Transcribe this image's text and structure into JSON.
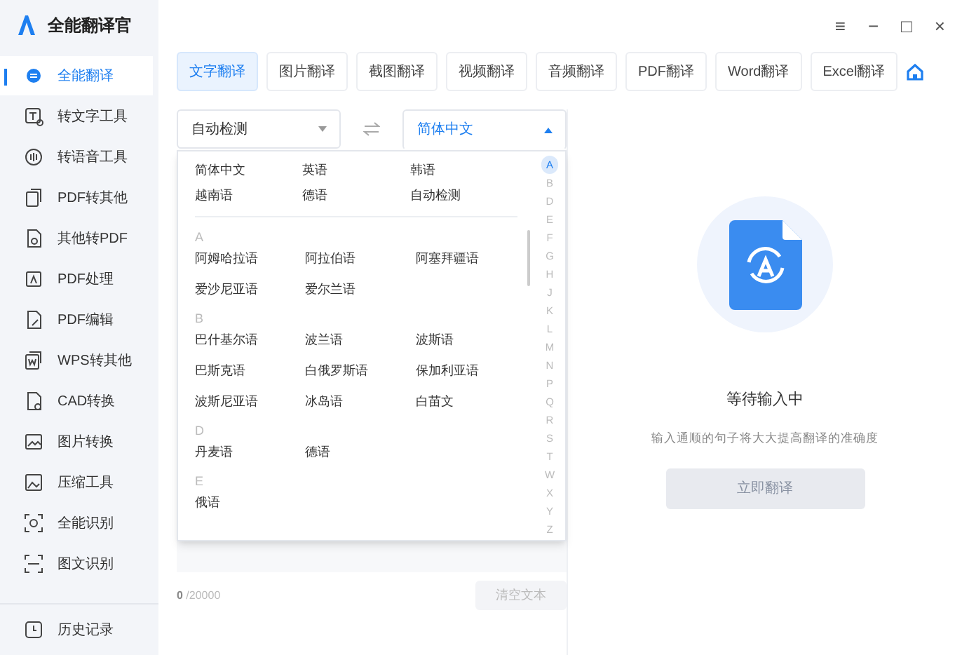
{
  "app": {
    "title": "全能翻译官"
  },
  "window_controls": [
    "≡",
    "−",
    "□",
    "×"
  ],
  "sidebar": {
    "items": [
      {
        "label": "全能翻译",
        "selected": true
      },
      {
        "label": "转文字工具",
        "selected": false
      },
      {
        "label": "转语音工具",
        "selected": false
      },
      {
        "label": "PDF转其他",
        "selected": false
      },
      {
        "label": "其他转PDF",
        "selected": false
      },
      {
        "label": "PDF处理",
        "selected": false
      },
      {
        "label": "PDF编辑",
        "selected": false
      },
      {
        "label": "WPS转其他",
        "selected": false
      },
      {
        "label": "CAD转换",
        "selected": false
      },
      {
        "label": "图片转换",
        "selected": false
      },
      {
        "label": "压缩工具",
        "selected": false
      },
      {
        "label": "全能识别",
        "selected": false
      },
      {
        "label": "图文识别",
        "selected": false
      }
    ],
    "footer": {
      "label": "历史记录"
    }
  },
  "tabs": [
    {
      "label": "文字翻译",
      "selected": true
    },
    {
      "label": "图片翻译",
      "selected": false
    },
    {
      "label": "截图翻译",
      "selected": false
    },
    {
      "label": "视频翻译",
      "selected": false
    },
    {
      "label": "音频翻译",
      "selected": false
    },
    {
      "label": "PDF翻译",
      "selected": false
    },
    {
      "label": "Word翻译",
      "selected": false
    },
    {
      "label": "Excel翻译",
      "selected": false
    }
  ],
  "source_language": {
    "value": "自动检测",
    "expanded": false
  },
  "target_language": {
    "value": "简体中文",
    "expanded": true
  },
  "language_menu": {
    "common": [
      "简体中文",
      "英语",
      "韩语",
      "越南语",
      "德语",
      "自动检测"
    ],
    "groups": [
      {
        "letter": "A",
        "languages": [
          "阿姆哈拉语",
          "阿拉伯语",
          "阿塞拜疆语",
          "爱沙尼亚语",
          "爱尔兰语"
        ]
      },
      {
        "letter": "B",
        "languages": [
          "巴什基尔语",
          "波兰语",
          "波斯语",
          "巴斯克语",
          "白俄罗斯语",
          "保加利亚语",
          "波斯尼亚语",
          "冰岛语",
          "白苗文"
        ]
      },
      {
        "letter": "D",
        "languages": [
          "丹麦语",
          "德语"
        ]
      },
      {
        "letter": "E",
        "languages": [
          "俄语"
        ]
      }
    ],
    "index": [
      {
        "letter": "A",
        "selected": true
      },
      {
        "letter": "B",
        "selected": false
      },
      {
        "letter": "D",
        "selected": false
      },
      {
        "letter": "E",
        "selected": false
      },
      {
        "letter": "F",
        "selected": false
      },
      {
        "letter": "G",
        "selected": false
      },
      {
        "letter": "H",
        "selected": false
      },
      {
        "letter": "J",
        "selected": false
      },
      {
        "letter": "K",
        "selected": false
      },
      {
        "letter": "L",
        "selected": false
      },
      {
        "letter": "M",
        "selected": false
      },
      {
        "letter": "N",
        "selected": false
      },
      {
        "letter": "P",
        "selected": false
      },
      {
        "letter": "Q",
        "selected": false
      },
      {
        "letter": "R",
        "selected": false
      },
      {
        "letter": "S",
        "selected": false
      },
      {
        "letter": "T",
        "selected": false
      },
      {
        "letter": "W",
        "selected": false
      },
      {
        "letter": "X",
        "selected": false
      },
      {
        "letter": "Y",
        "selected": false
      },
      {
        "letter": "Z",
        "selected": false
      }
    ]
  },
  "input": {
    "count": "0",
    "limit": "/20000",
    "clear_button": "清空文本"
  },
  "result": {
    "title": "等待输入中",
    "hint": "输入通顺的句子将大大提高翻译的准确度",
    "button": "立即翻译"
  }
}
